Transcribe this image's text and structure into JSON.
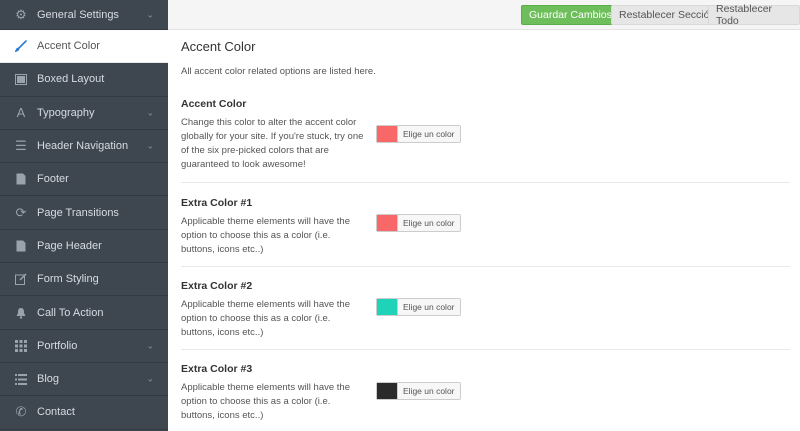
{
  "sidebar": {
    "items": [
      {
        "label": "General Settings",
        "icon": "gear-icon",
        "chevron": true
      },
      {
        "label": "Accent Color",
        "icon": "brush-icon",
        "chevron": false,
        "active": true
      },
      {
        "label": "Boxed Layout",
        "icon": "layout-icon",
        "chevron": false
      },
      {
        "label": "Typography",
        "icon": "typography-icon",
        "chevron": true
      },
      {
        "label": "Header Navigation",
        "icon": "menu-icon",
        "chevron": true
      },
      {
        "label": "Footer",
        "icon": "document-icon",
        "chevron": false
      },
      {
        "label": "Page Transitions",
        "icon": "refresh-icon",
        "chevron": false
      },
      {
        "label": "Page Header",
        "icon": "page-icon",
        "chevron": false
      },
      {
        "label": "Form Styling",
        "icon": "edit-icon",
        "chevron": false
      },
      {
        "label": "Call To Action",
        "icon": "bell-icon",
        "chevron": false
      },
      {
        "label": "Portfolio",
        "icon": "grid-icon",
        "chevron": true
      },
      {
        "label": "Blog",
        "icon": "list-icon",
        "chevron": true
      },
      {
        "label": "Contact",
        "icon": "phone-icon",
        "chevron": false
      }
    ]
  },
  "toolbar": {
    "save_label": "Guardar Cambios",
    "reset_section_label": "Restablecer Sección",
    "reset_all_label": "Restablecer Todo"
  },
  "main": {
    "title": "Accent Color",
    "description": "All accent color related options are listed here.",
    "options": [
      {
        "title": "Accent Color",
        "description": "Change this color to alter the accent color globally for your site. If you're stuck, try one of the six pre-picked colors that are guaranteed to look awesome!",
        "color": "#f96868",
        "button_label": "Elige un color"
      },
      {
        "title": "Extra Color #1",
        "description": "Applicable theme elements will have the option to choose this as a color (i.e. buttons, icons etc..)",
        "color": "#f96868",
        "button_label": "Elige un color"
      },
      {
        "title": "Extra Color #2",
        "description": "Applicable theme elements will have the option to choose this as a color (i.e. buttons, icons etc..)",
        "color": "#1ed3b7",
        "button_label": "Elige un color"
      },
      {
        "title": "Extra Color #3",
        "description": "Applicable theme elements will have the option to choose this as a color (i.e. buttons, icons etc..)",
        "color": "#2b2b2b",
        "button_label": "Elige un color"
      }
    ]
  },
  "colors": {
    "sidebar_bg": "#3e4650",
    "save_green": "#6ebf5c",
    "active_icon_blue": "#2a7bd3"
  }
}
